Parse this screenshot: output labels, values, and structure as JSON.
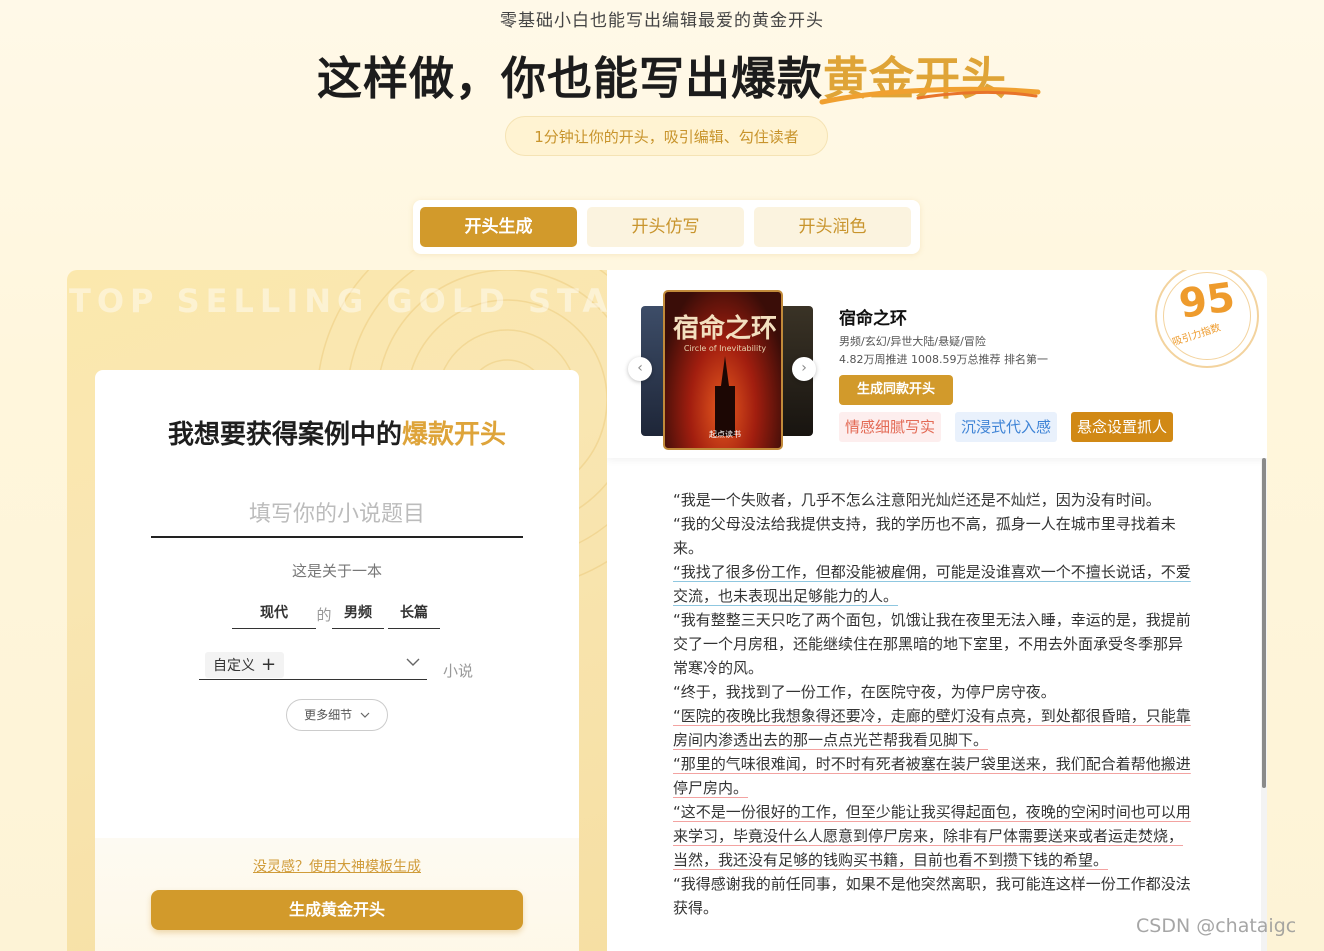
{
  "header": {
    "top_sub": "零基础小白也能写出编辑最爱的黄金开头",
    "title_main": "这样做，你也能写出爆款",
    "title_gold": "黄金开头",
    "pill": "1分钟让你的开头，吸引编辑、勾住读者"
  },
  "tabs": [
    "开头生成",
    "开头仿写",
    "开头润色"
  ],
  "left": {
    "watermark": "TOP SELLING GOLD START",
    "form_title_main": "我想要获得案例中的",
    "form_title_gold": "爆款开头",
    "input_placeholder": "填写你的小说题目",
    "about": "这是关于一本",
    "era": "现代",
    "de": "的",
    "gender": "男频",
    "length": "长篇",
    "custom_label": "自定义",
    "custom_plus": "+",
    "xiaoshuo": "小说",
    "more_details": "更多细节",
    "template_link": "没灵感？使用大神模板生成",
    "generate_button": "生成黄金开头"
  },
  "book": {
    "cover_title": "宿命之环",
    "cover_sub": "Circle of Inevitability",
    "cover_publisher": "起点读书",
    "name": "宿命之环",
    "genre": "男频/玄幻/异世大陆/悬疑/冒险",
    "stats": "4.82万周推进 1008.59万总推荐 排名第一",
    "same_button": "生成同款开头",
    "tags": [
      "情感细腻写实",
      "沉浸式代入感",
      "悬念设置抓人"
    ],
    "score": "95",
    "score_label": "吸引力指数"
  },
  "story": [
    "“我是一个失败者，几乎不怎么注意阳光灿烂还是不灿烂，因为没有时间。",
    "“我的父母没法给我提供支持，我的学历也不高，孤身一人在城市里寻找着未来。",
    "“我找了很多份工作，但都没能被雇佣，可能是没谁喜欢一个不擅长说话，不爱交流，也未表现出足够能力的人。",
    "“我有整整三天只吃了两个面包，饥饿让我在夜里无法入睡，幸运的是，我提前交了一个月房租，还能继续住在那黑暗的地下室里，不用去外面承受冬季那异常寒冷的风。",
    "“终于，我找到了一份工作，在医院守夜，为停尸房守夜。",
    "“医院的夜晚比我想象得还要冷，走廊的壁灯没有点亮，到处都很昏暗，只能靠房间内渗透出去的那一点点光芒帮我看见脚下。",
    "“那里的气味很难闻，时不时有死者被塞在装尸袋里送来，我们配合着帮他搬进停尸房内。",
    "“这不是一份很好的工作，但至少能让我买得起面包，夜晚的空闲时间也可以用来学习，毕竟没什么人愿意到停尸房来，除非有尸体需要送来或者运走焚烧，当然，我还没有足够的钱购买书籍，目前也看不到攒下钱的希望。",
    "“我得感谢我的前任同事，如果不是他突然离职，我可能连这样一份工作都没法获得。"
  ],
  "watermark_footer": "CSDN @chataigc"
}
